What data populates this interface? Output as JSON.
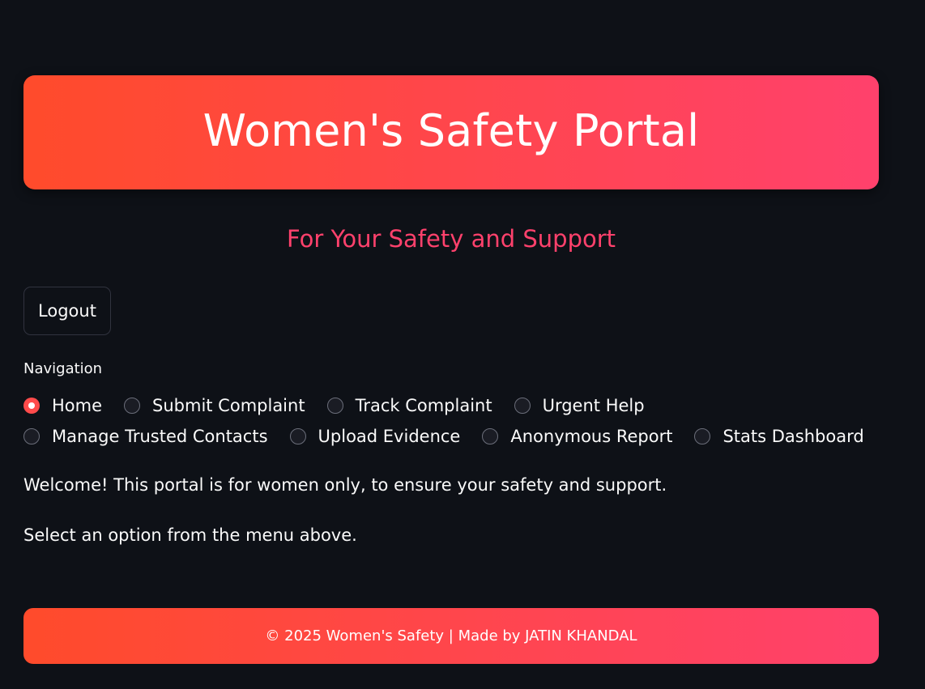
{
  "header": {
    "title": "Women's Safety Portal",
    "subtitle": "For Your Safety and Support"
  },
  "logout_label": "Logout",
  "navigation": {
    "label": "Navigation",
    "selected": "Home",
    "options": [
      {
        "label": "Home",
        "checked": true
      },
      {
        "label": "Submit Complaint",
        "checked": false
      },
      {
        "label": "Track Complaint",
        "checked": false
      },
      {
        "label": "Urgent Help",
        "checked": false
      },
      {
        "label": "Manage Trusted Contacts",
        "checked": false
      },
      {
        "label": "Upload Evidence",
        "checked": false
      },
      {
        "label": "Anonymous Report",
        "checked": false
      },
      {
        "label": "Stats Dashboard",
        "checked": false
      }
    ]
  },
  "main": {
    "welcome_text": "Welcome! This portal is for women only, to ensure your safety and support.",
    "instruction_text": "Select an option from the menu above."
  },
  "footer": {
    "text": "© 2025 Women's Safety | Made by JATIN KHANDAL"
  },
  "colors": {
    "background": "#0e1117",
    "gradient_start": "#ff4b2b",
    "gradient_end": "#ff416c",
    "accent": "#ff416c",
    "radio_selected": "#ff4b4b"
  }
}
